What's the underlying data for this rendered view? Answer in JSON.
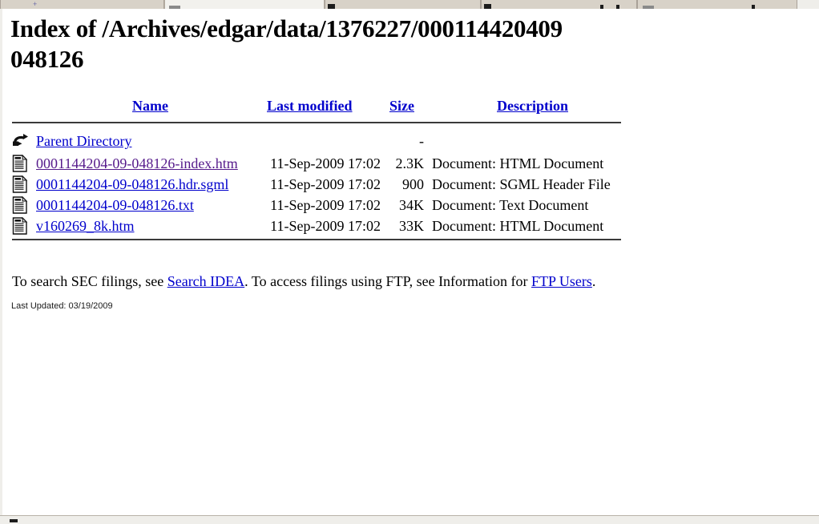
{
  "browser": {
    "tabs": [
      {
        "name": "tab-1",
        "active": false
      },
      {
        "name": "tab-2",
        "active": true
      },
      {
        "name": "tab-3",
        "active": false
      },
      {
        "name": "tab-4",
        "active": false
      },
      {
        "name": "tab-5",
        "active": false
      }
    ],
    "new_tab_label": "+"
  },
  "page": {
    "title": "Index of /Archives/edgar/data/1376227/000114420409048126"
  },
  "listing": {
    "headers": {
      "name": "Name",
      "last_modified": "Last modified",
      "size": "Size",
      "description": "Description"
    },
    "rows": [
      {
        "icon": "back-arrow-icon",
        "name": "Parent Directory",
        "link_state": "unvisited",
        "last_modified": "",
        "size": "-",
        "description": ""
      },
      {
        "icon": "text-document-icon",
        "name": "0001144204-09-048126-index.htm",
        "link_state": "visited",
        "last_modified": "11-Sep-2009 17:02",
        "size": "2.3K",
        "description": "Document: HTML Document"
      },
      {
        "icon": "text-document-icon",
        "name": "0001144204-09-048126.hdr.sgml",
        "link_state": "unvisited",
        "last_modified": "11-Sep-2009 17:02",
        "size": "900",
        "description": "Document: SGML Header File"
      },
      {
        "icon": "text-document-icon",
        "name": "0001144204-09-048126.txt",
        "link_state": "unvisited",
        "last_modified": "11-Sep-2009 17:02",
        "size": "34K",
        "description": "Document: Text Document"
      },
      {
        "icon": "text-document-icon",
        "name": "v160269_8k.htm",
        "link_state": "unvisited",
        "last_modified": "11-Sep-2009 17:02",
        "size": "33K",
        "description": "Document: HTML Document"
      }
    ]
  },
  "footer": {
    "text_before_idea": "To search SEC filings, see ",
    "search_idea_link": "Search IDEA",
    "text_between": ". To access filings using FTP, see Information for ",
    "ftp_users_link": "FTP Users",
    "text_end": ".",
    "last_updated": "Last Updated: 03/19/2009"
  },
  "colors": {
    "link": "#0000cc",
    "visited_link": "#551a8b",
    "rule": "#3a3a3a",
    "chrome": "#efeeea",
    "tab": "#d8d2c8"
  }
}
